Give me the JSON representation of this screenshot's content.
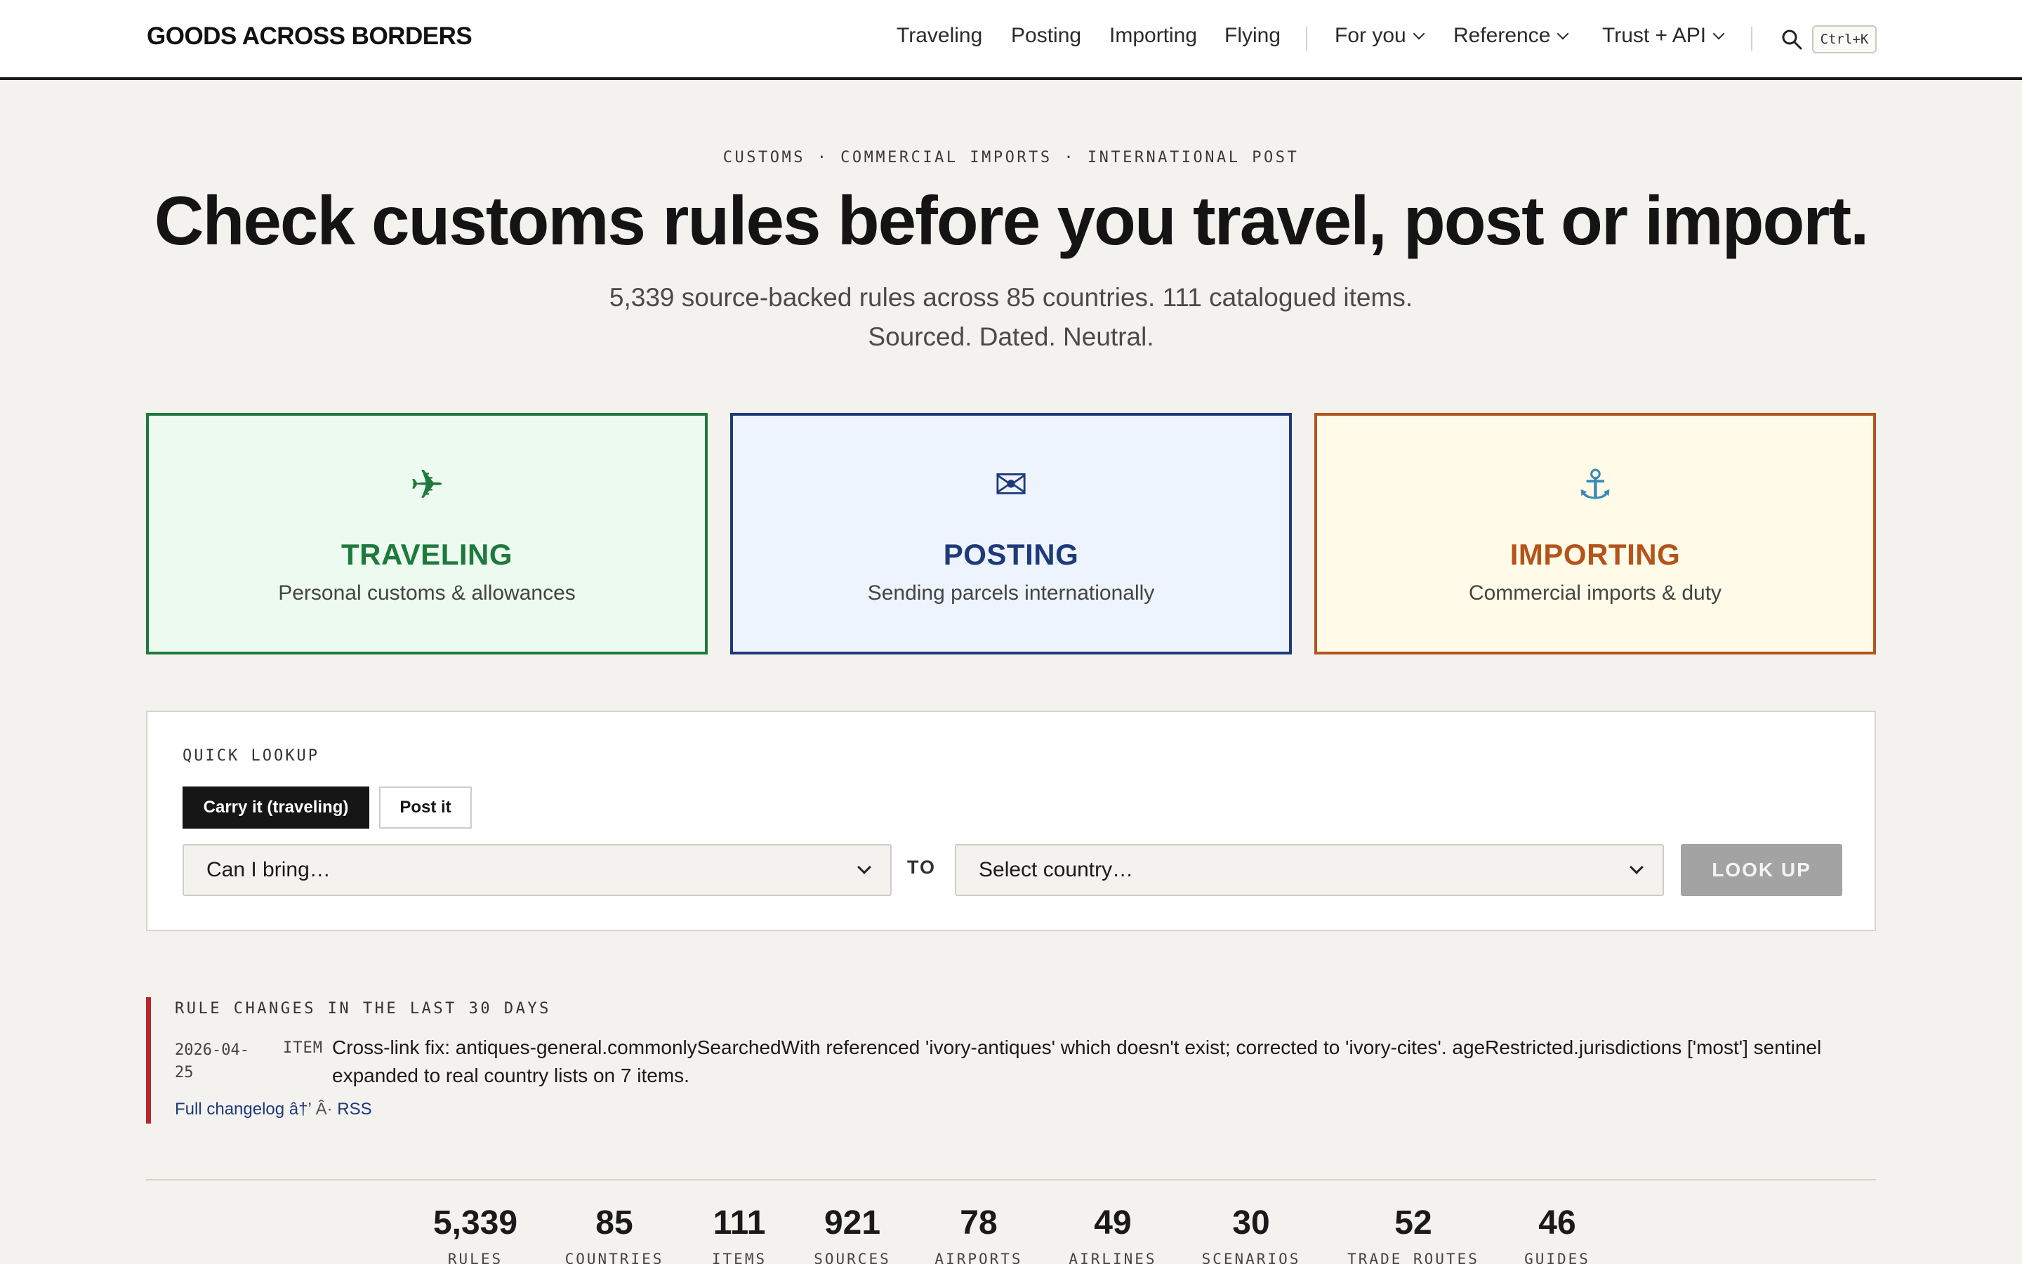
{
  "header": {
    "brand": "GOODS ACROSS BORDERS",
    "nav_primary": [
      "Traveling",
      "Posting",
      "Importing",
      "Flying"
    ],
    "nav_menus": [
      "For you",
      "Reference",
      "Trust + API"
    ],
    "search_shortcut": "Ctrl+K"
  },
  "hero": {
    "eyebrow": "CUSTOMS · COMMERCIAL IMPORTS · INTERNATIONAL POST",
    "title": "Check customs rules before you travel, post or import.",
    "subtitle": "5,339 source-backed rules across 85 countries. 111 catalogued items. Sourced. Dated. Neutral."
  },
  "modes": [
    {
      "icon": "✈",
      "icon_name": "airplane-icon",
      "title": "TRAVELING",
      "subtitle": "Personal customs & allowances",
      "color": "#1e7a3c"
    },
    {
      "icon": "✉",
      "icon_name": "envelope-icon",
      "title": "POSTING",
      "subtitle": "Sending parcels internationally",
      "color": "#1e3a7a"
    },
    {
      "icon": "⚓",
      "icon_name": "anchor-icon",
      "title": "IMPORTING",
      "subtitle": "Commercial imports & duty",
      "color": "#b4531a"
    }
  ],
  "lookup": {
    "label": "QUICK LOOKUP",
    "tabs": [
      "Carry it (traveling)",
      "Post it"
    ],
    "item_select": "Can I bring…",
    "to_label": "TO",
    "country_select": "Select country…",
    "button": "LOOK UP"
  },
  "changes": {
    "label": "RULE CHANGES IN THE LAST 30 DAYS",
    "entries": [
      {
        "date": "2026-04-25",
        "kind": "ITEM",
        "text": "Cross-link fix: antiques-general.commonlySearchedWith referenced 'ivory-antiques' which doesn't exist; corrected to 'ivory-cites'. ageRestricted.jurisdictions ['most'] sentinel expanded to real country lists on 7 items."
      }
    ],
    "changelog_link": "Full changelog â†’",
    "separator": " Â· ",
    "rss_link": "RSS"
  },
  "stats": [
    {
      "value": "5,339",
      "label": "RULES"
    },
    {
      "value": "85",
      "label": "COUNTRIES"
    },
    {
      "value": "111",
      "label": "ITEMS"
    },
    {
      "value": "921",
      "label": "SOURCES"
    },
    {
      "value": "78",
      "label": "AIRPORTS"
    },
    {
      "value": "49",
      "label": "AIRLINES"
    },
    {
      "value": "30",
      "label": "SCENARIOS"
    },
    {
      "value": "52",
      "label": "TRADE ROUTES"
    },
    {
      "value": "46",
      "label": "GUIDES"
    }
  ]
}
